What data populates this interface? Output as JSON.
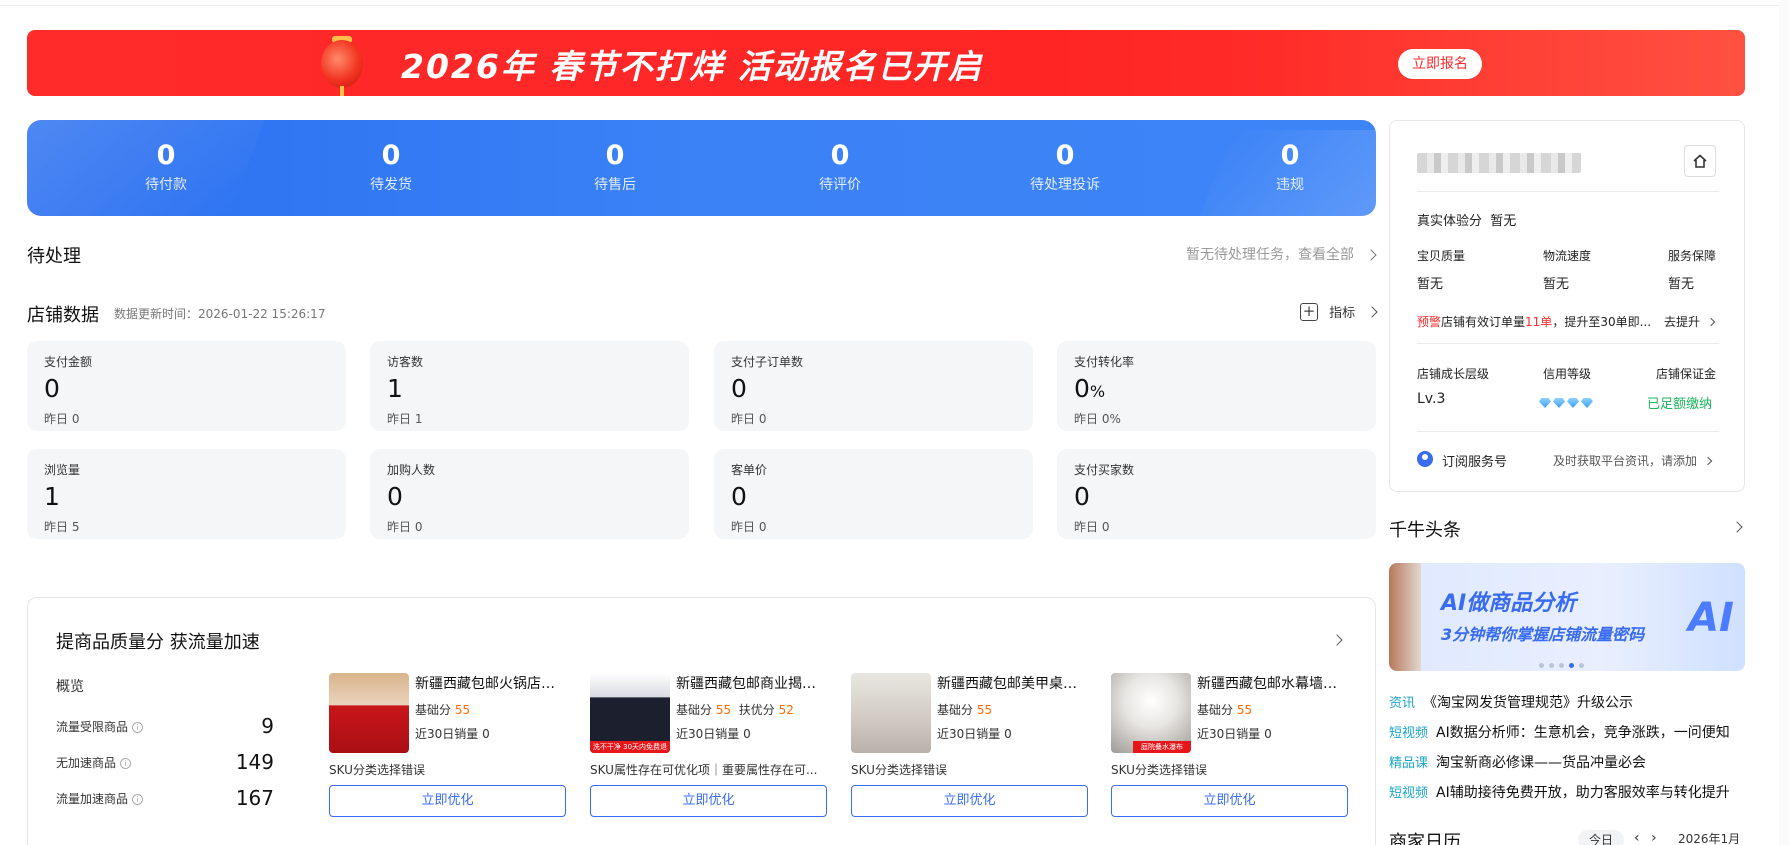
{
  "banner": {
    "title": "2026年 春节不打烊 活动报名已开启",
    "button": "立即报名"
  },
  "order_status": [
    {
      "count": "0",
      "label": "待付款"
    },
    {
      "count": "0",
      "label": "待发货"
    },
    {
      "count": "0",
      "label": "待售后"
    },
    {
      "count": "0",
      "label": "待评价"
    },
    {
      "count": "0",
      "label": "待处理投诉"
    },
    {
      "count": "0",
      "label": "违规"
    }
  ],
  "pending": {
    "title": "待处理",
    "link": "暂无待处理任务，查看全部"
  },
  "store_data": {
    "title": "店铺数据",
    "update_time": "数据更新时间：2026-01-22 15:26:17",
    "metrics_button": "指标",
    "cards": [
      {
        "title": "支付金额",
        "value": "0",
        "unit": "",
        "yesterday": "昨日 0"
      },
      {
        "title": "访客数",
        "value": "1",
        "unit": "",
        "yesterday": "昨日 1"
      },
      {
        "title": "支付子订单数",
        "value": "0",
        "unit": "",
        "yesterday": "昨日 0"
      },
      {
        "title": "支付转化率",
        "value": "0",
        "unit": "%",
        "yesterday": "昨日 0%"
      },
      {
        "title": "浏览量",
        "value": "1",
        "unit": "",
        "yesterday": "昨日 5"
      },
      {
        "title": "加购人数",
        "value": "0",
        "unit": "",
        "yesterday": "昨日 0"
      },
      {
        "title": "客单价",
        "value": "0",
        "unit": "",
        "yesterday": "昨日 0"
      },
      {
        "title": "支付买家数",
        "value": "0",
        "unit": "",
        "yesterday": "昨日 0"
      }
    ]
  },
  "quality": {
    "title": "提商品质量分 获流量加速",
    "overview": "概览",
    "rows": [
      {
        "label": "流量受限商品",
        "value": "9"
      },
      {
        "label": "无加速商品",
        "value": "149"
      },
      {
        "label": "流量加速商品",
        "value": "167"
      }
    ],
    "products": [
      {
        "name": "新疆西藏包邮火锅店调...",
        "base_label": "基础分",
        "base": "55",
        "extra_label": "",
        "extra": "",
        "sales": "近30日销量 0",
        "issue": "SKU分类选择错误",
        "button": "立即优化",
        "thumb_color": "#c8161b"
      },
      {
        "name": "新疆西藏包邮商业揭盖...",
        "base_label": "基础分",
        "base": "55",
        "extra_label": "扶优分",
        "extra": "52",
        "sales": "近30日销量 0",
        "issue": "SKU属性存在可优化项｜重要属性存在可...",
        "button": "立即优化",
        "thumb_color": "#1b1f2e",
        "thumb_caption": "洗不干净 30天内免费退"
      },
      {
        "name": "新疆西藏包邮美甲桌椅...",
        "base_label": "基础分",
        "base": "55",
        "extra_label": "",
        "extra": "",
        "sales": "近30日销量 0",
        "issue": "SKU分类选择错误",
        "button": "立即优化",
        "thumb_color": "#cfc9c2"
      },
      {
        "name": "新疆西藏包邮水幕墙流...",
        "base_label": "基础分",
        "base": "55",
        "extra_label": "",
        "extra": "",
        "sales": "近30日销量 0",
        "issue": "SKU分类选择错误",
        "button": "立即优化",
        "thumb_color": "#e8e6e2",
        "thumb_caption": "庭院叠水瀑布"
      }
    ]
  },
  "account": {
    "real_score_label": "真实体验分",
    "real_score_value": "暂无",
    "scores": [
      {
        "label": "宝贝质量",
        "value": "暂无"
      },
      {
        "label": "物流速度",
        "value": "暂无"
      },
      {
        "label": "服务保障",
        "value": "暂无"
      }
    ],
    "warning_tag": "预警",
    "warning_text_a": "店铺有效订单量",
    "warning_count": "11单",
    "warning_text_b": "，提升至30单即...",
    "warning_action": "去提升",
    "growth_label": "店铺成长层级",
    "growth_value": "Lv.3",
    "credit_label": "信用等级",
    "credit_gems": 4,
    "deposit_label": "店铺保证金",
    "deposit_value": "已足额缴纳",
    "subscribe_label": "订阅服务号",
    "subscribe_hint": "及时获取平台资讯，请添加"
  },
  "news": {
    "title": "千牛头条",
    "carousel_title": "AI做商品分析",
    "carousel_sub": "3分钟帮你掌握店铺流量密码",
    "carousel_logo": "AI",
    "carousel_index": 4,
    "carousel_count": 5,
    "items": [
      {
        "tag": "资讯",
        "text": "《淘宝网发货管理规范》升级公示"
      },
      {
        "tag": "短视频",
        "text": "AI数据分析师：生意机会，竞争涨跌，一问便知"
      },
      {
        "tag": "精品课",
        "text": "淘宝新商必修课——货品冲量必会"
      },
      {
        "tag": "短视频",
        "text": "AI辅助接待免费开放，助力客服效率与转化提升"
      }
    ]
  },
  "calendar": {
    "title": "商家日历",
    "today": "今日",
    "month": "2026年1月"
  },
  "colors": {
    "banner_red": "#ff2a2a",
    "status_blue": "#3b82f6",
    "accent_blue": "#3a6cf0",
    "orange": "#ff6a00",
    "green": "#1bb55c"
  }
}
